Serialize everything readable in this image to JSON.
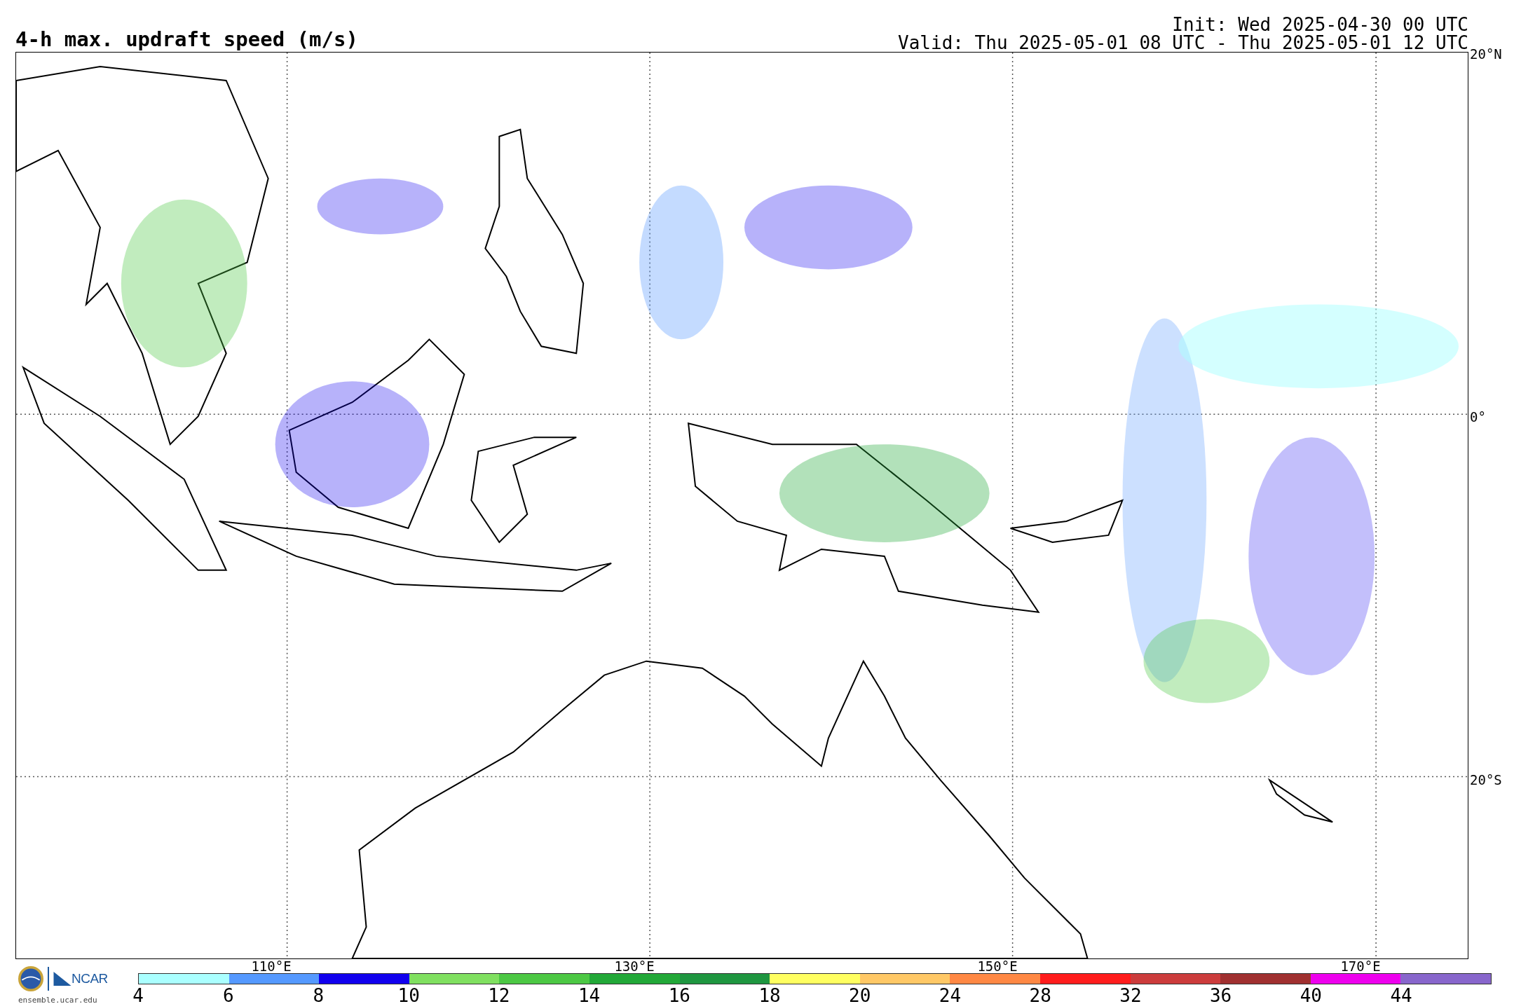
{
  "title": "4-h max. updraft speed (m/s)",
  "init": "Init: Wed 2025-04-30 00 UTC",
  "valid": "Valid: Thu 2025-05-01 08 UTC - Thu 2025-05-01 12 UTC",
  "map": {
    "latitude_labels": [
      "20°N",
      "0°",
      "20°S"
    ],
    "longitude_labels": [
      "110°E",
      "130°E",
      "150°E",
      "170°E"
    ]
  },
  "colorbar": [
    {
      "label": "4",
      "color": "#aaffff"
    },
    {
      "label": "6",
      "color": "#5599ff"
    },
    {
      "label": "8",
      "color": "#1100ee"
    },
    {
      "label": "10",
      "color": "#80e060"
    },
    {
      "label": "12",
      "color": "#4cc844"
    },
    {
      "label": "14",
      "color": "#22a838"
    },
    {
      "label": "16",
      "color": "#1e9640"
    },
    {
      "label": "18",
      "color": "#ffff60"
    },
    {
      "label": "20",
      "color": "#ffc866"
    },
    {
      "label": "24",
      "color": "#ff8844"
    },
    {
      "label": "28",
      "color": "#ff1c1c"
    },
    {
      "label": "32",
      "color": "#cc3c3c"
    },
    {
      "label": "36",
      "color": "#a03030"
    },
    {
      "label": "40",
      "color": "#ee00ee"
    },
    {
      "label": "44",
      "color": "#8866cc"
    }
  ],
  "logo": {
    "name": "NCAR",
    "url": "ensemble.ucar.edu"
  }
}
